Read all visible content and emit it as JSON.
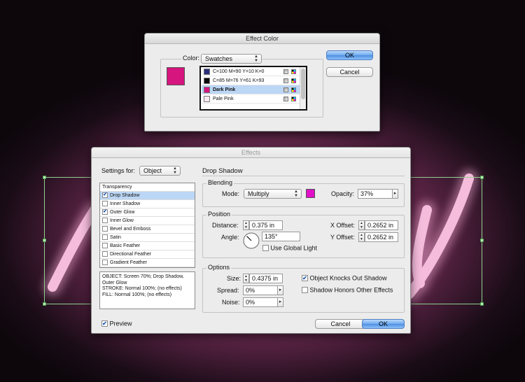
{
  "canvas": {
    "neon_color": "#f5bcdc",
    "background_glow": "#b9497e",
    "selection_color": "#8fd08f"
  },
  "effect_color": {
    "title": "Effect Color",
    "color_label": "Color:",
    "color_value": "Swatches",
    "preview_color": "#d6157e",
    "swatches": [
      {
        "name": "C=100 M=90 Y=10 K=0",
        "color": "#2b2f7a",
        "selected": false,
        "bold": false
      },
      {
        "name": "C=85 M=76 Y=61 K=93",
        "color": "#0b0b0b",
        "selected": false,
        "bold": false
      },
      {
        "name": "Dark Pink",
        "color": "#d8137f",
        "selected": true,
        "bold": true
      },
      {
        "name": "Pale Pink",
        "color": "#fbe9f1",
        "selected": false,
        "bold": false
      }
    ],
    "ok_label": "OK",
    "cancel_label": "Cancel"
  },
  "effects": {
    "title": "Effects",
    "settings_for_label": "Settings for:",
    "settings_for_value": "Object",
    "section_title": "Drop Shadow",
    "list": [
      {
        "label": "Transparency",
        "checkbox": false,
        "checked": false,
        "selected": false
      },
      {
        "label": "Drop Shadow",
        "checkbox": true,
        "checked": true,
        "selected": true
      },
      {
        "label": "Inner Shadow",
        "checkbox": true,
        "checked": false,
        "selected": false
      },
      {
        "label": "Outer Glow",
        "checkbox": true,
        "checked": true,
        "selected": false
      },
      {
        "label": "Inner Glow",
        "checkbox": true,
        "checked": false,
        "selected": false
      },
      {
        "label": "Bevel and Emboss",
        "checkbox": true,
        "checked": false,
        "selected": false
      },
      {
        "label": "Satin",
        "checkbox": true,
        "checked": false,
        "selected": false
      },
      {
        "label": "Basic Feather",
        "checkbox": true,
        "checked": false,
        "selected": false
      },
      {
        "label": "Directional Feather",
        "checkbox": true,
        "checked": false,
        "selected": false
      },
      {
        "label": "Gradient Feather",
        "checkbox": true,
        "checked": false,
        "selected": false
      }
    ],
    "summary": [
      "OBJECT: Screen 70%; Drop Shadow,",
      "Outer Glow",
      "STROKE: Normal 100%; (no effects)",
      "FILL: Normal 100%; (no effects)"
    ],
    "blending": {
      "title": "Blending",
      "mode_label": "Mode:",
      "mode_value": "Multiply",
      "swatch_color": "#e010c8",
      "opacity_label": "Opacity:",
      "opacity_value": "37%"
    },
    "position": {
      "title": "Position",
      "distance_label": "Distance:",
      "distance_value": "0.375 in",
      "angle_label": "Angle:",
      "angle_value": "135°",
      "angle_degrees": 135,
      "global_light_label": "Use Global Light",
      "global_light_checked": false,
      "x_offset_label": "X Offset:",
      "x_offset_value": "0.2652 in",
      "y_offset_label": "Y Offset:",
      "y_offset_value": "0.2652 in"
    },
    "options": {
      "title": "Options",
      "size_label": "Size:",
      "size_value": "0.4375 in",
      "spread_label": "Spread:",
      "spread_value": "0%",
      "noise_label": "Noise:",
      "noise_value": "0%",
      "knocks_out_label": "Object Knocks Out Shadow",
      "knocks_out_checked": true,
      "honors_label": "Shadow Honors Other Effects",
      "honors_checked": false
    },
    "preview_label": "Preview",
    "preview_checked": true,
    "cancel_label": "Cancel",
    "ok_label": "OK"
  }
}
